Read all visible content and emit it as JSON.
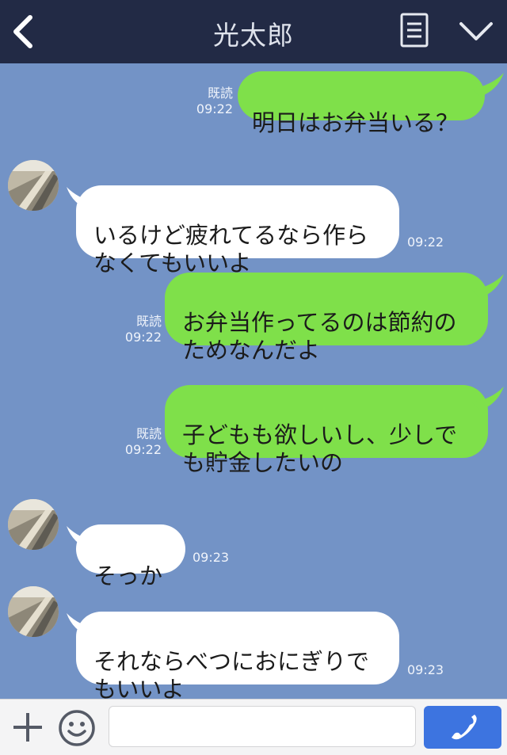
{
  "header": {
    "title": "光太郎",
    "back_icon": "chevron-left-icon",
    "menu_icon": "list-icon",
    "expand_icon": "chevron-down-icon"
  },
  "messages": [
    {
      "text": "明日はお弁当いる？",
      "read": "既読",
      "time": "09:22",
      "direction": "outgoing"
    },
    {
      "text": "いるけど疲れてるなら作ら\nなくてもいいよ",
      "time": "09:22",
      "direction": "incoming"
    },
    {
      "text": "お弁当作ってるのは節約の\nためなんだよ",
      "read": "既読",
      "time": "09:22",
      "direction": "outgoing"
    },
    {
      "text": "子どもも欲しいし、少しで\nも貯金したいの",
      "read": "既読",
      "time": "09:22",
      "direction": "outgoing"
    },
    {
      "text": "そっか",
      "time": "09:23",
      "direction": "incoming"
    },
    {
      "text": "それならべつにおにぎりで\nもいいよ",
      "time": "09:23",
      "direction": "incoming"
    }
  ],
  "footer": {
    "input_value": "",
    "plus_icon": "plus-icon",
    "emoji_icon": "smiley-icon",
    "call_icon": "phone-icon"
  },
  "colors": {
    "header_bg": "#222a45",
    "chat_bg": "#7393c6",
    "outgoing_bubble": "#7fe04a",
    "incoming_bubble": "#ffffff",
    "call_button": "#3d74e0"
  }
}
